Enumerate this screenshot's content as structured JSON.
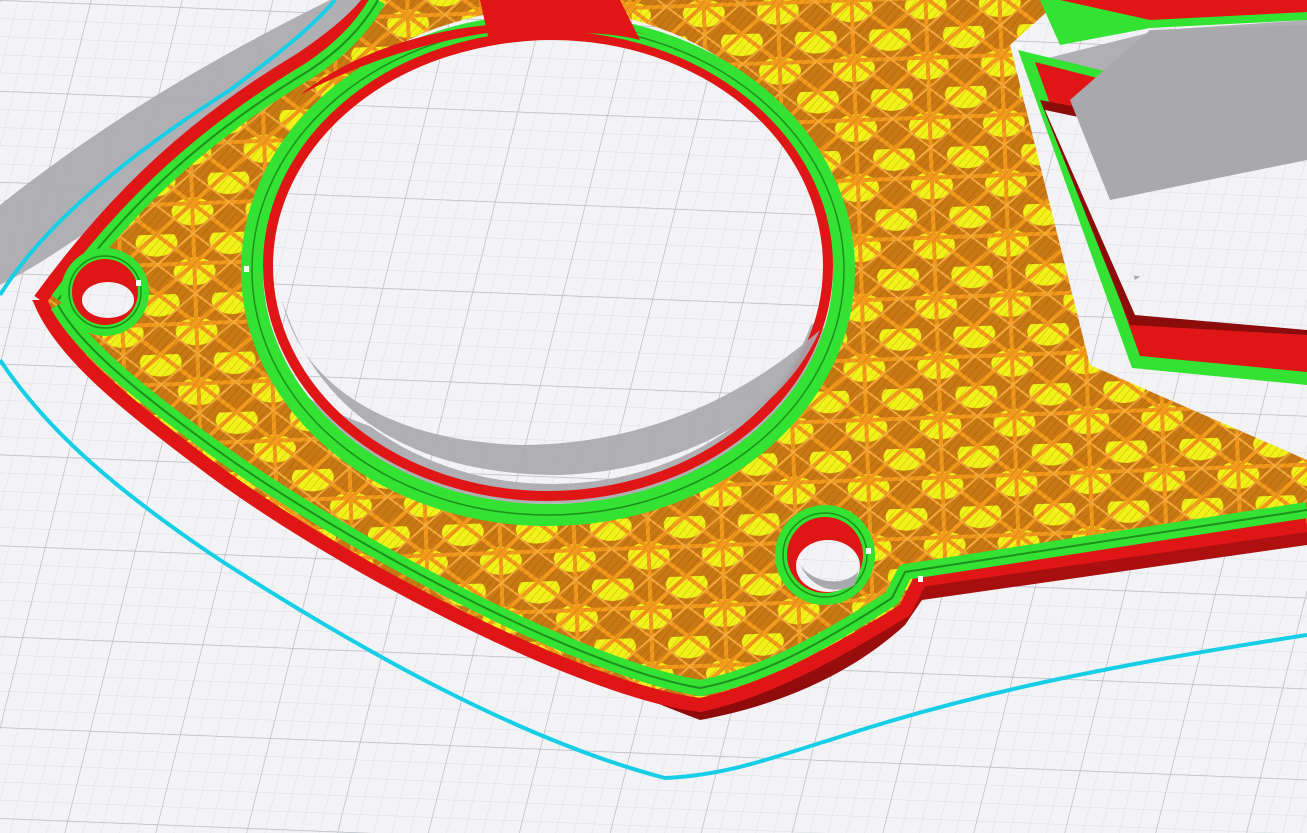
{
  "scene": {
    "view": "3d-layer-preview",
    "colors": {
      "bed": "#f3f3f5",
      "bed_grid_minor": "#dadce1",
      "bed_grid_major": "#b9bcc3",
      "shadow": "#a9a9ad",
      "outer_wall": "#e01616",
      "outer_wall_dark": "#8c0b0b",
      "inner_wall": "#33e233",
      "inner_wall_dark": "#1c8f1c",
      "infill": "#f39a1c",
      "infill_dark": "#b86a0c",
      "top_fill": "#f2f21a",
      "top_fill_dark": "#3a3a06",
      "skirt": "#16cfe6",
      "seam": "#ffffff"
    },
    "features": [
      "outer-wall",
      "inner-wall",
      "infill",
      "top-solid-infill",
      "skirt",
      "layer-seam"
    ]
  }
}
